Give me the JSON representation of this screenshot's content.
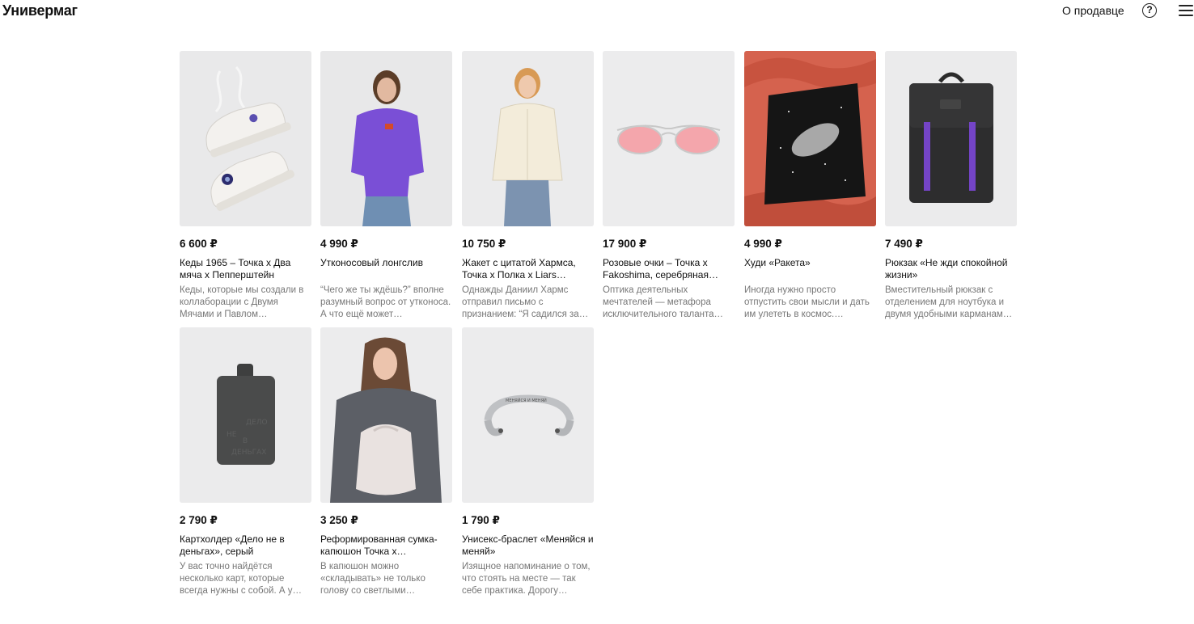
{
  "header": {
    "logo": "Универмаг",
    "seller_link": "О продавце",
    "help_glyph": "?",
    "help_icon": "help-circle-icon",
    "menu_icon": "hamburger-menu-icon"
  },
  "currency": "₽",
  "products": [
    {
      "price": "6 600 ₽",
      "title": "Кеды 1965 – Точка х Два мяча х Пепперштейн",
      "desc": "Кеды, которые мы создали в коллаборации с Двумя Мячами и Павлом…",
      "image": "white-sneakers"
    },
    {
      "price": "4 990 ₽",
      "title": "Утконосовый лонгслив",
      "desc": "“Чего же ты ждёшь?” вполне разумный вопрос от утконоса. А что ещё может…",
      "image": "purple-longsleeve"
    },
    {
      "price": "10 750 ₽",
      "title": "Жакет с цитатой Хармса, Точка х Полка х Liars…",
      "desc": "Однажды Даниил Хармс отправил письмо с признанием: “Я садился за…",
      "image": "cream-jacket"
    },
    {
      "price": "17 900 ₽",
      "title": "Розовые очки – Точка х Fakoshima, серебряная…",
      "desc": "Оптика деятельных мечтателей — метафора исключительного таланта…",
      "image": "pink-glasses"
    },
    {
      "price": "4 990 ₽",
      "title": "Худи «Ракета»",
      "desc": "Иногда нужно просто отпустить свои мысли и дать им улететь в космос.…",
      "image": "rocket-hoodie"
    },
    {
      "price": "7 490 ₽",
      "title": "Рюкзак «Не жди спокойной жизни»",
      "desc": "Вместительный рюкзак с отделением для ноутбука и двумя удобными карманам…",
      "image": "black-backpack"
    },
    {
      "price": "2 790 ₽",
      "title": "Картхолдер «Дело не в деньгах», серый",
      "desc": "У вас точно найдётся несколько карт, которые всегда нужны с собой. А у…",
      "image": "card-holder",
      "emboss": [
        "НЕ",
        "ДЕЛО",
        "В",
        "ДЕНЬГАХ"
      ]
    },
    {
      "price": "3 250 ₽",
      "title": "Реформированная сумка-капюшон Точка х…",
      "desc": "В капюшон можно «складывать» не только голову со светлыми…",
      "image": "hood-bag"
    },
    {
      "price": "1 790 ₽",
      "title": "Унисекс-браслет «Меняйся и меняй»",
      "desc": "Изящное напоминание о том, что стоять на месте — так себе практика. Дорогу…",
      "image": "silver-bracelet",
      "engraving": "МЕНЯЙСЯ И МЕНЯЙ"
    }
  ]
}
